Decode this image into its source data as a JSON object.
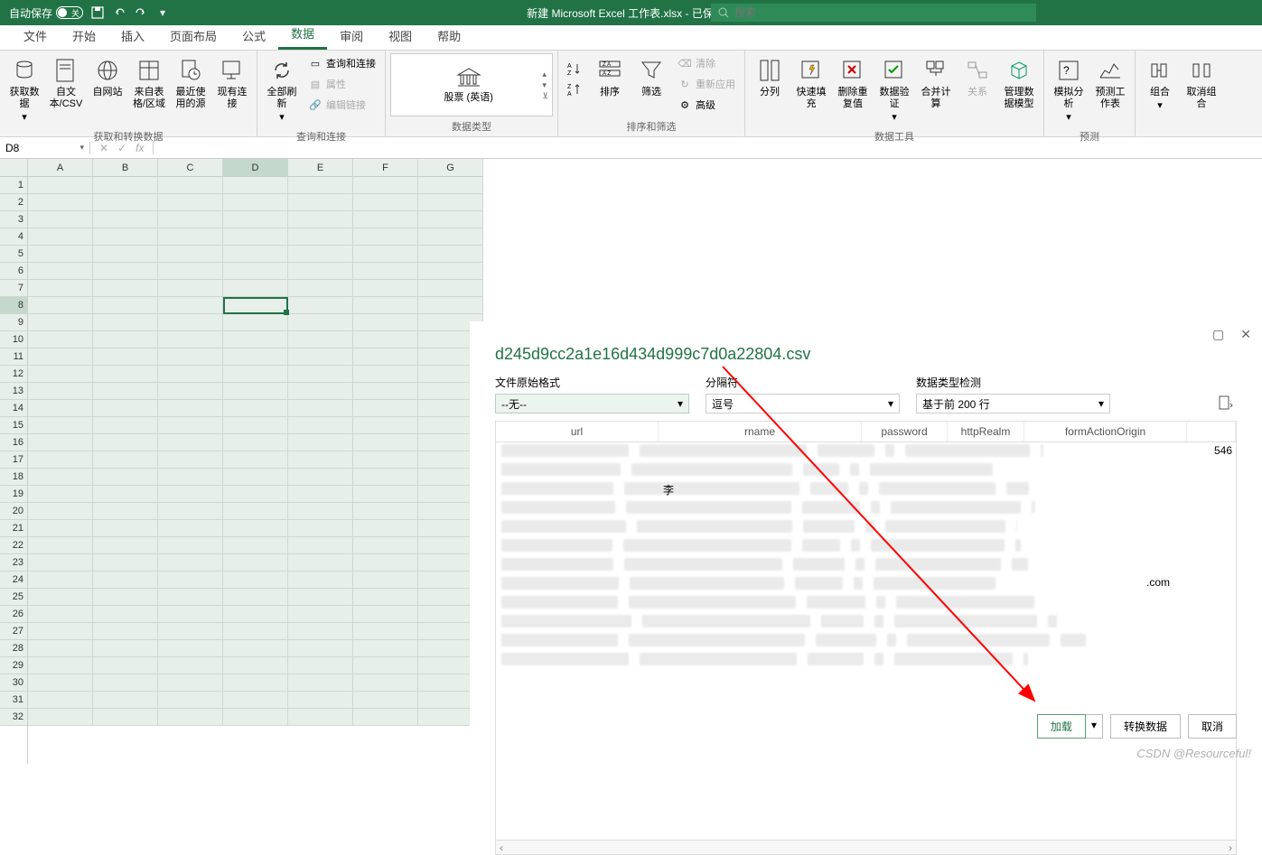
{
  "titlebar": {
    "auto_save": "自动保存",
    "toggle_state": "关",
    "doc_title": "新建 Microsoft Excel 工作表.xlsx - 已保存",
    "search_placeholder": "搜索"
  },
  "tabs": [
    "文件",
    "开始",
    "插入",
    "页面布局",
    "公式",
    "数据",
    "审阅",
    "视图",
    "帮助"
  ],
  "active_tab": "数据",
  "ribbon": {
    "group1": {
      "label": "获取和转换数据",
      "items": {
        "get_data": "获取数据",
        "from_csv": "自文本/CSV",
        "from_web": "自网站",
        "from_range": "来自表格/区域",
        "recent": "最近使用的源",
        "existing": "现有连接"
      }
    },
    "group2": {
      "label": "查询和连接",
      "refresh_all": "全部刷新",
      "queries": "查询和连接",
      "properties": "属性",
      "edit_links": "编辑链接"
    },
    "group3": {
      "label": "数据类型",
      "stock": "股票 (英语)"
    },
    "group4": {
      "label": "排序和筛选",
      "sort": "排序",
      "filter": "筛选",
      "clear": "清除",
      "reapply": "重新应用",
      "advanced": "高级"
    },
    "group5": {
      "label": "数据工具",
      "text_to_col": "分列",
      "flash_fill": "快速填充",
      "remove_dup": "删除重复值",
      "validation": "数据验证",
      "consolidate": "合并计算",
      "relations": "关系",
      "data_model": "管理数据模型"
    },
    "group6": {
      "label": "预测",
      "whatif": "模拟分析",
      "forecast": "预测工作表"
    },
    "group7": {
      "group": "组合",
      "ungroup": "取消组合"
    }
  },
  "name_box": "D8",
  "columns": [
    "A",
    "B",
    "C",
    "D",
    "E",
    "F",
    "G"
  ],
  "rows": 32,
  "selected_cell": {
    "row": 8,
    "col": "D"
  },
  "preview": {
    "title": "d245d9cc2a1e16d434d999c7d0a22804.csv",
    "file_origin_label": "文件原始格式",
    "file_origin_value": "--无--",
    "delimiter_label": "分隔符",
    "delimiter_value": "逗号",
    "detect_label": "数据类型检测",
    "detect_value": "基于前 200 行",
    "headers": [
      "url",
      "rname",
      "password",
      "httpRealm",
      "formActionOrigin"
    ],
    "visible_text_1": "李",
    "visible_text_2": ".com",
    "visible_text_3": "546",
    "load": "加载",
    "transform": "转换数据",
    "cancel": "取消"
  },
  "watermark": "CSDN @Resourceful!"
}
